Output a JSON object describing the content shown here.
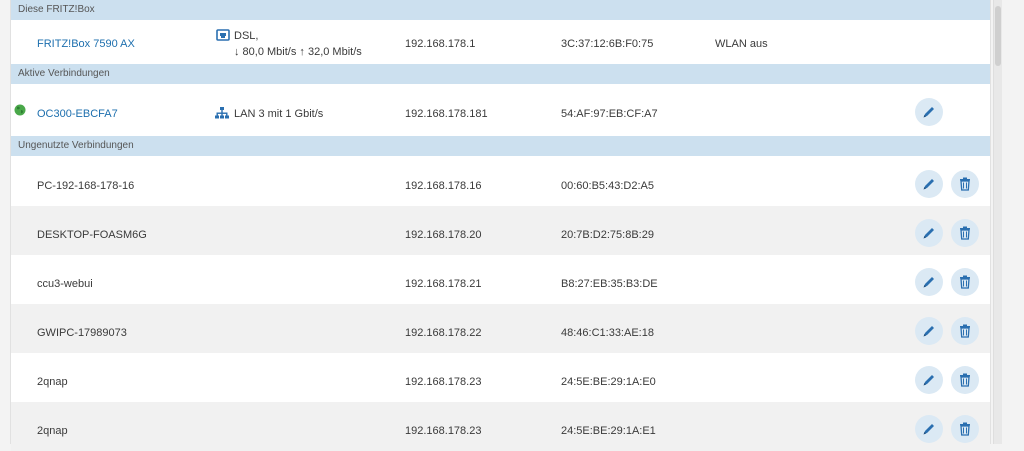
{
  "colors": {
    "section_header": "#cce0ef",
    "link": "#1d6fae",
    "button_bg": "#dbe9f4",
    "icon": "#2a6fb0"
  },
  "sections": {
    "this_box": {
      "label": "Diese FRITZ!Box"
    },
    "active": {
      "label": "Aktive Verbindungen"
    },
    "unused": {
      "label": "Ungenutzte Verbindungen"
    }
  },
  "fritzbox": {
    "name": "FRITZ!Box 7590 AX",
    "conn_type": "DSL,",
    "conn_rates": "↓ 80,0 Mbit/s ↑ 32,0 Mbit/s",
    "conn_icon": "dsl-icon",
    "ip": "192.168.178.1",
    "mac": "3C:37:12:6B:F0:75",
    "wlan": "WLAN aus"
  },
  "active": {
    "name": "OC300-EBCFA7",
    "status_icon": "globe-icon",
    "conn": "LAN 3 mit 1 Gbit/s",
    "conn_icon": "lan-icon",
    "ip": "192.168.178.181",
    "mac": "54:AF:97:EB:CF:A7"
  },
  "unused": [
    {
      "name": "PC-192-168-178-16",
      "ip": "192.168.178.16",
      "mac": "00:60:B5:43:D2:A5"
    },
    {
      "name": "DESKTOP-FOASM6G",
      "ip": "192.168.178.20",
      "mac": "20:7B:D2:75:8B:29"
    },
    {
      "name": "ccu3-webui",
      "ip": "192.168.178.21",
      "mac": "B8:27:EB:35:B3:DE"
    },
    {
      "name": "GWIPC-17989073",
      "ip": "192.168.178.22",
      "mac": "48:46:C1:33:AE:18"
    },
    {
      "name": "2qnap",
      "ip": "192.168.178.23",
      "mac": "24:5E:BE:29:1A:E0"
    },
    {
      "name": "2qnap",
      "ip": "192.168.178.23",
      "mac": "24:5E:BE:29:1A:E1"
    }
  ]
}
